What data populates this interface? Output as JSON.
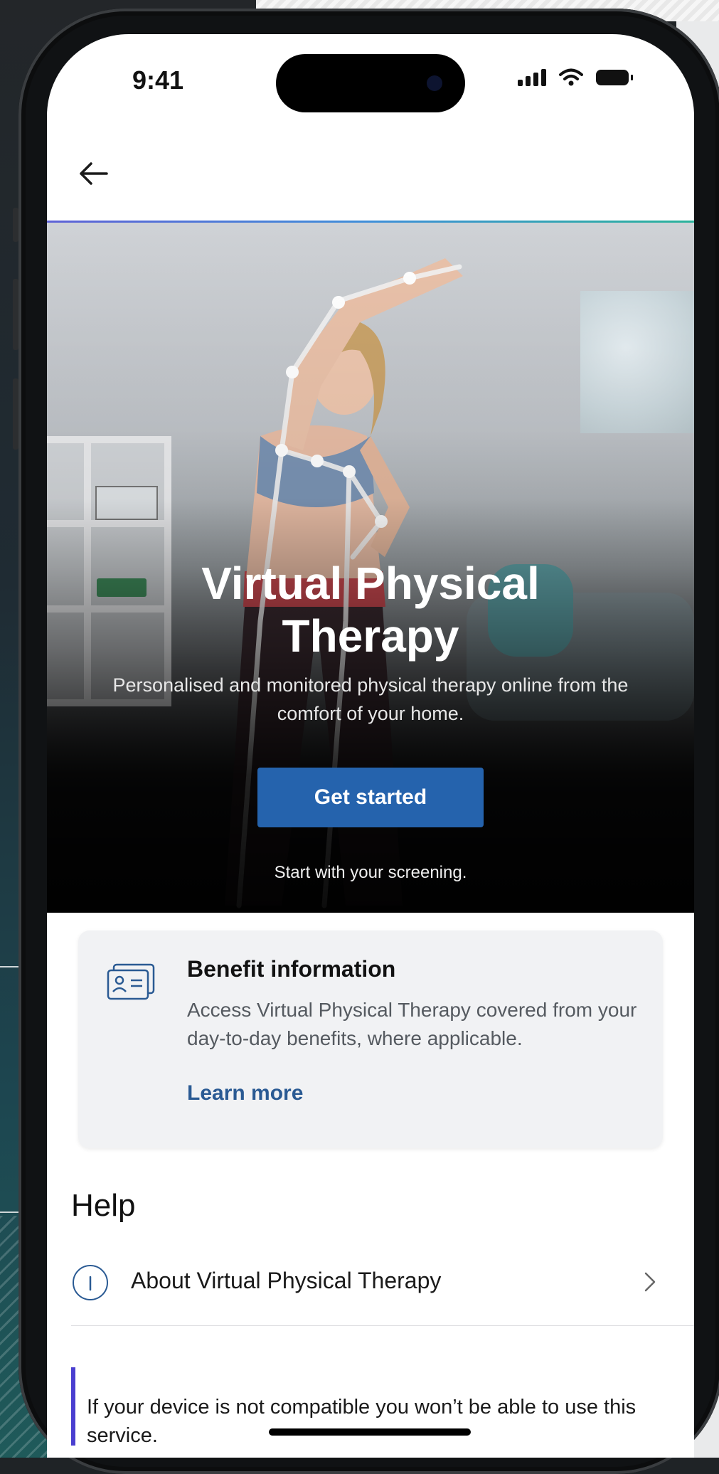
{
  "status_bar": {
    "time": "9:41"
  },
  "nav": {
    "back_icon": "arrow-left-icon"
  },
  "hero": {
    "title_line1": "Virtual Physical",
    "title_line2": "Therapy",
    "subtitle": "Personalised and monitored physical therapy online from the comfort of your home.",
    "cta_label": "Get started",
    "cta_note": "Start with your screening."
  },
  "benefit_card": {
    "icon": "id-card-icon",
    "title": "Benefit information",
    "body": "Access Virtual Physical Therapy covered from your day-to-day benefits, where applicable.",
    "link_label": "Learn more"
  },
  "help": {
    "title": "Help",
    "items": [
      {
        "icon": "info-circle-icon",
        "label": "About Virtual Physical Therapy"
      }
    ]
  },
  "notice": {
    "text": "If your device is not compatible you won’t be able to use this service."
  },
  "colors": {
    "primary_button": "#2563ad",
    "link": "#2a5a93",
    "notice_accent": "#4a3fd0"
  }
}
